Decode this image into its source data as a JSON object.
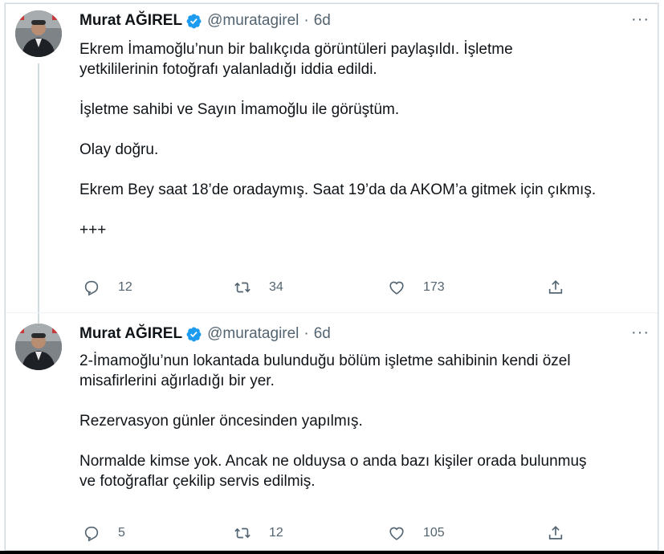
{
  "tweets": [
    {
      "name": "Murat AĞIREL",
      "handle": "@muratagirel",
      "separator": "·",
      "time": "6d",
      "more": "···",
      "paragraphs": [
        "Ekrem İmamoğlu’nun bir balıkçıda görüntüleri paylaşıldı. İşletme\nyetkililerinin fotoğrafı yalanladığı iddia edildi.",
        "İşletme sahibi ve Sayın İmamoğlu ile görüştüm.",
        "Olay doğru.",
        "Ekrem Bey saat 18’de oradaymış. Saat 19’da da AKOM’a gitmek için çıkmış.",
        "+++"
      ],
      "replies": "12",
      "retweets": "34",
      "likes": "173"
    },
    {
      "name": "Murat AĞIREL",
      "handle": "@muratagirel",
      "separator": "·",
      "time": "6d",
      "more": "···",
      "paragraphs": [
        "2-İmamoğlu’nun lokantada bulunduğu bölüm işletme sahibinin kendi özel\nmisafirlerini ağırladığı bir yer.",
        "Rezervasyon günler öncesinden yapılmış.",
        "Normalde kimse yok. Ancak ne olduysa o anda bazı kişiler orada bulunmuş\nve fotoğraflar çekilip servis edilmiş."
      ],
      "replies": "5",
      "retweets": "12",
      "likes": "105"
    }
  ],
  "icons": {
    "verified": "verified-badge-icon",
    "reply": "reply-icon",
    "retweet": "retweet-icon",
    "like": "heart-icon",
    "share": "share-icon"
  },
  "colors": {
    "text": "#0f1419",
    "secondary": "#536471",
    "verified": "#1d9bf0",
    "divider": "#eff3f4"
  }
}
